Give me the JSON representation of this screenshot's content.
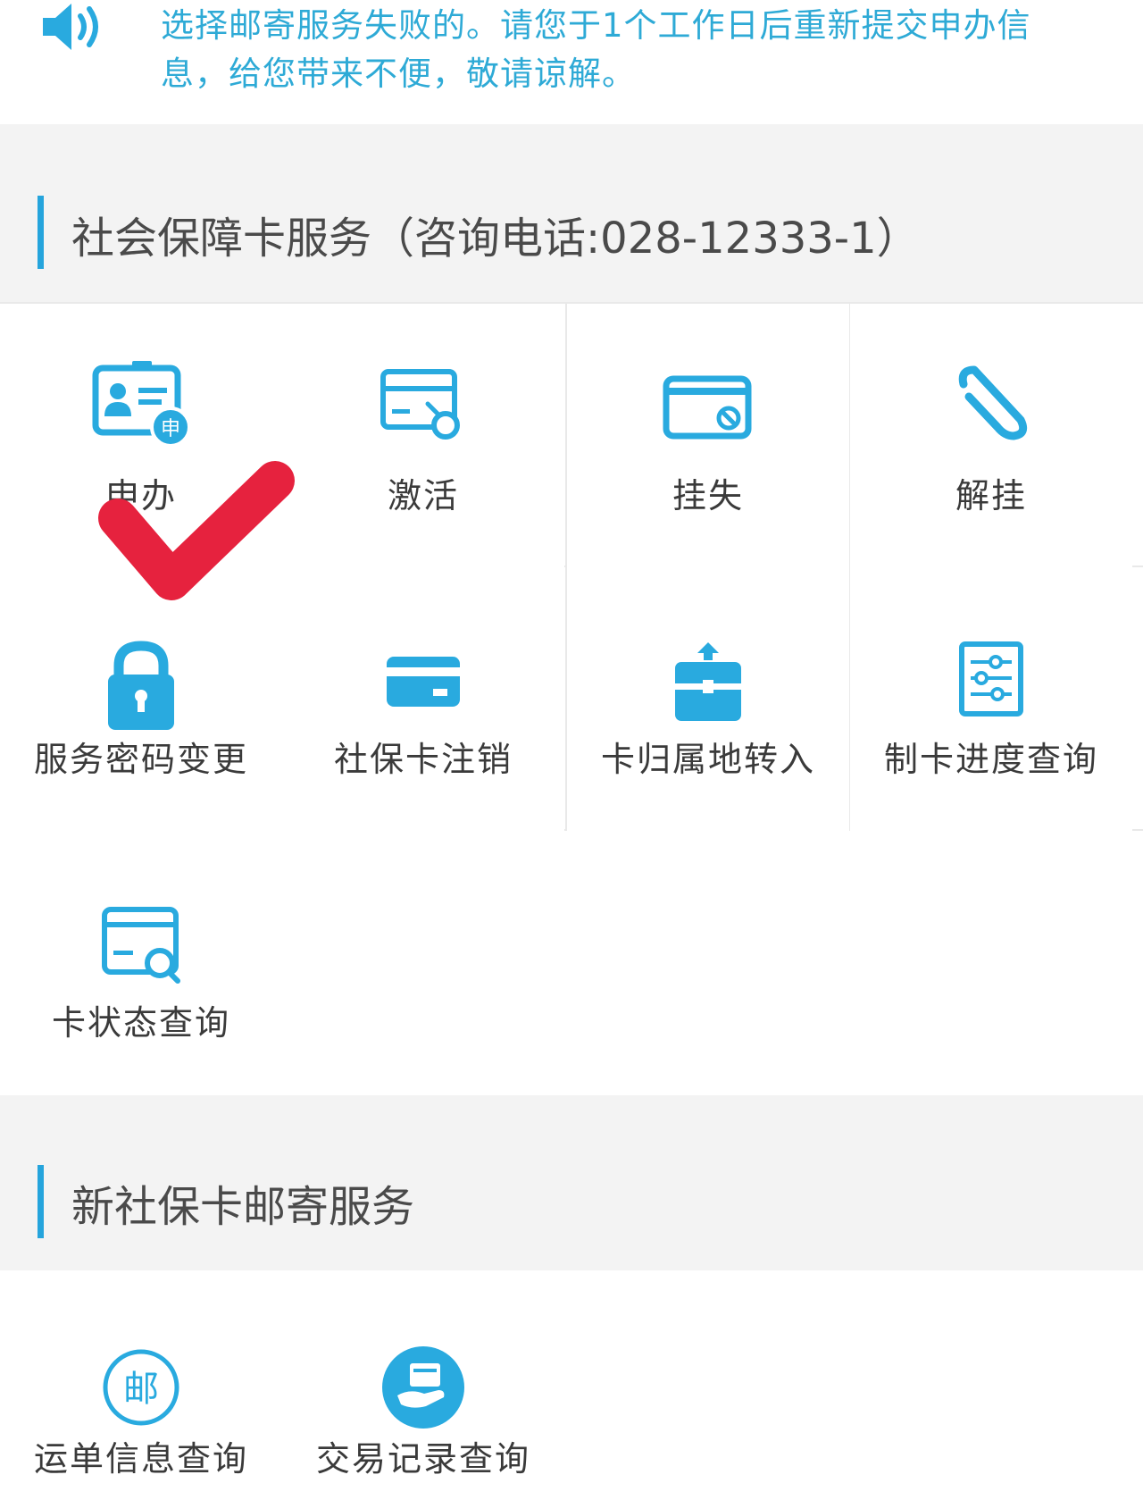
{
  "notice": {
    "text": "选择邮寄服务失败的。请您于1个工作日后重新提交申办信息，给您带来不便，敬请谅解。"
  },
  "section_card_services": {
    "title": "社会保障卡服务（咨询电话:028-12333-1）",
    "items": [
      {
        "label": "申办",
        "icon": "id-card-apply-icon",
        "badge": "申"
      },
      {
        "label": "激活",
        "icon": "card-activate-icon"
      },
      {
        "label": "挂失",
        "icon": "card-report-loss-icon"
      },
      {
        "label": "解挂",
        "icon": "paperclip-icon"
      },
      {
        "label": "服务密码变更",
        "icon": "lock-icon"
      },
      {
        "label": "社保卡注销",
        "icon": "card-cancel-icon"
      },
      {
        "label": "卡归属地转入",
        "icon": "briefcase-transfer-icon"
      },
      {
        "label": "制卡进度查询",
        "icon": "progress-settings-icon"
      },
      {
        "label": "卡状态查询",
        "icon": "card-search-icon"
      }
    ]
  },
  "section_mail_services": {
    "title": "新社保卡邮寄服务",
    "items": [
      {
        "label": "运单信息查询",
        "icon": "mail-circle-icon",
        "badge": "邮"
      },
      {
        "label": "交易记录查询",
        "icon": "hand-card-icon"
      }
    ]
  },
  "colors": {
    "accent": "#25a4dc",
    "icon": "#29aadf",
    "checkmark": "#e6223e",
    "section_bg": "#f3f3f3"
  }
}
